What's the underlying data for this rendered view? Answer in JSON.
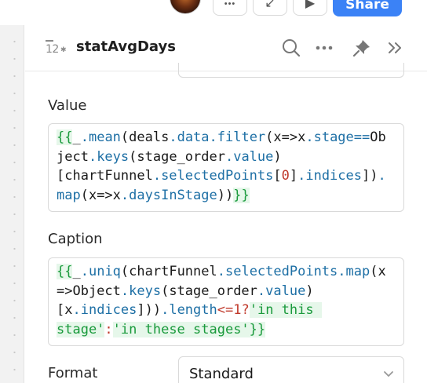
{
  "toolbar": {
    "share_label": "Share",
    "more_glyph": "•••",
    "collapse_glyph": "↙",
    "play_glyph": "▶"
  },
  "panel": {
    "type_label": "12",
    "title": "statAvgDays",
    "icons": [
      "search-icon",
      "more-icon",
      "pin-icon",
      "expand-icon"
    ]
  },
  "fields": {
    "value": {
      "label": "Value",
      "lines": [
        "{{_.mean(deals.data.filter(x=>x.stage==Ob",
        "ject.keys(stage_order.value)",
        "[chartFunnel.selectedPoints[0].indices]).",
        "map(x=>x.daysInStage))}}"
      ]
    },
    "caption": {
      "label": "Caption",
      "lines": [
        "{{_.uniq(chartFunnel.selectedPoints.map(x",
        "=>Object.keys(stage_order.value)",
        "[x.indices])).length<=1?'in this ",
        "stage':'in these stages'}}"
      ]
    },
    "format": {
      "label": "Format",
      "selected": "Standard"
    }
  },
  "colors": {
    "accent": "#3b82f6",
    "brace": "#1a9a3c",
    "property": "#1d6fa5",
    "number": "#c0392b",
    "string": "#1a9a3c",
    "highlight": "#e6f7ea"
  }
}
